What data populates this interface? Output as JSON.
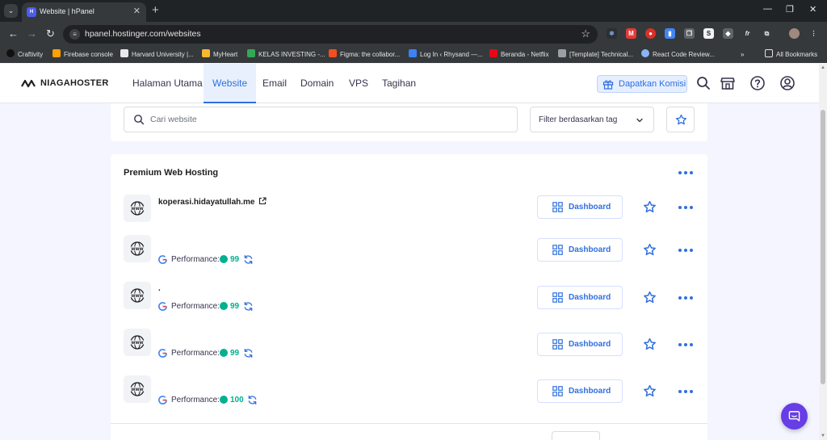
{
  "browser": {
    "tab_title": "Website | hPanel",
    "new_tab_icon": "plus-icon",
    "url": "hpanel.hostinger.com/websites",
    "bookmarks": [
      {
        "label": "Craftivity",
        "color": "#111111"
      },
      {
        "label": "Firebase console",
        "color": "#ffa000"
      },
      {
        "label": "Harvard University |...",
        "color": "#e8eaed"
      },
      {
        "label": "MyHeart",
        "color": "#f5b82e"
      },
      {
        "label": "KELAS INVESTING -...",
        "color": "#34a853"
      },
      {
        "label": "Figma: the collabor...",
        "color": "#f24e1e"
      },
      {
        "label": "Log In ‹ Rhysand —...",
        "color": "#3b82f6"
      },
      {
        "label": "Beranda - Netflix",
        "color": "#e50914"
      },
      {
        "label": "[Template] Technical...",
        "color": "#9aa0a6"
      },
      {
        "label": "React Code Review...",
        "color": "#8ab4f8"
      }
    ],
    "all_bookmarks_label": "All Bookmarks"
  },
  "header": {
    "brand": "NIAGAHOSTER",
    "nav": [
      {
        "label": "Halaman Utama",
        "active": false
      },
      {
        "label": "Website",
        "active": true
      },
      {
        "label": "Email",
        "active": false
      },
      {
        "label": "Domain",
        "active": false
      },
      {
        "label": "VPS",
        "active": false
      },
      {
        "label": "Tagihan",
        "active": false
      }
    ],
    "commission_button": "Dapatkan Komisi",
    "accent_color": "#2f6fe0"
  },
  "search": {
    "placeholder": "Cari website",
    "value": "",
    "filter_label": "Filter berdasarkan tag"
  },
  "hosting": {
    "title": "Premium Web Hosting",
    "dashboard_label": "Dashboard",
    "performance_label": "Performance:",
    "websites": [
      {
        "domain": "koperasi.hidayatullah.me",
        "external_link": true,
        "score": ""
      },
      {
        "domain": "",
        "external_link": false,
        "score": "99"
      },
      {
        "domain": ".",
        "external_link": false,
        "score": "99"
      },
      {
        "domain": "",
        "external_link": false,
        "score": "99"
      },
      {
        "domain": "",
        "external_link": false,
        "score": "100"
      }
    ],
    "score_color": "#00b090"
  }
}
